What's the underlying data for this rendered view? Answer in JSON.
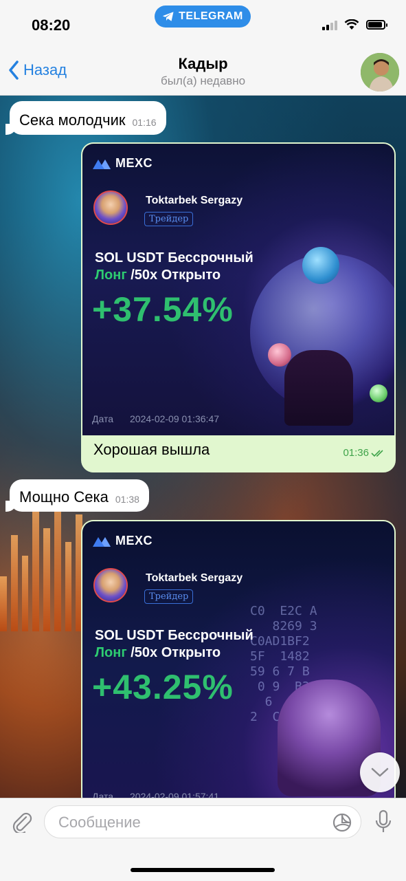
{
  "status_bar": {
    "time": "08:20",
    "app_pill": "TELEGRAM",
    "battery_level": 0.9
  },
  "header": {
    "back_label": "Назад",
    "title": "Кадыр",
    "subtitle": "был(а) недавно"
  },
  "messages": [
    {
      "direction": "in",
      "text": "Сека молодчик",
      "time": "01:16"
    },
    {
      "direction": "out",
      "card": {
        "brand": "MEXC",
        "trader_name": "Toktarbek Sergazy",
        "trader_badge": "Трейдер",
        "pair_line1": "SOL USDT Бессрочный",
        "pair_side": "Лонг",
        "pair_line2_rest": " /50x Открыто",
        "pnl": "+37.54%",
        "date_label": "Дата",
        "date_value": "2024-02-09 01:36:47"
      },
      "caption": "Хорошая вышла",
      "time": "01:36",
      "status_icon": "double-check-icon"
    },
    {
      "direction": "in",
      "text": "Мощно Сека",
      "time": "01:38"
    },
    {
      "direction": "out",
      "card": {
        "brand": "MEXC",
        "trader_name": "Toktarbek Sergazy",
        "trader_badge": "Трейдер",
        "pair_line1": "SOL USDT Бессрочный",
        "pair_side": "Лонг",
        "pair_line2_rest": " /50x Открыто",
        "pnl": "+43.25%",
        "date_label": "Дата",
        "date_value": "2024-02-09 01:57:41"
      }
    }
  ],
  "input": {
    "placeholder": "Сообщение"
  },
  "icons": {
    "attach": "paperclip-icon",
    "sticker": "sticker-icon",
    "mic": "microphone-icon",
    "scroll": "chevron-down-icon"
  },
  "colors": {
    "accent": "#2481e0",
    "outgoing_bubble": "#e1f7cf",
    "pnl_green": "#2fbf6f",
    "telegram_pill": "#2e8de8"
  }
}
